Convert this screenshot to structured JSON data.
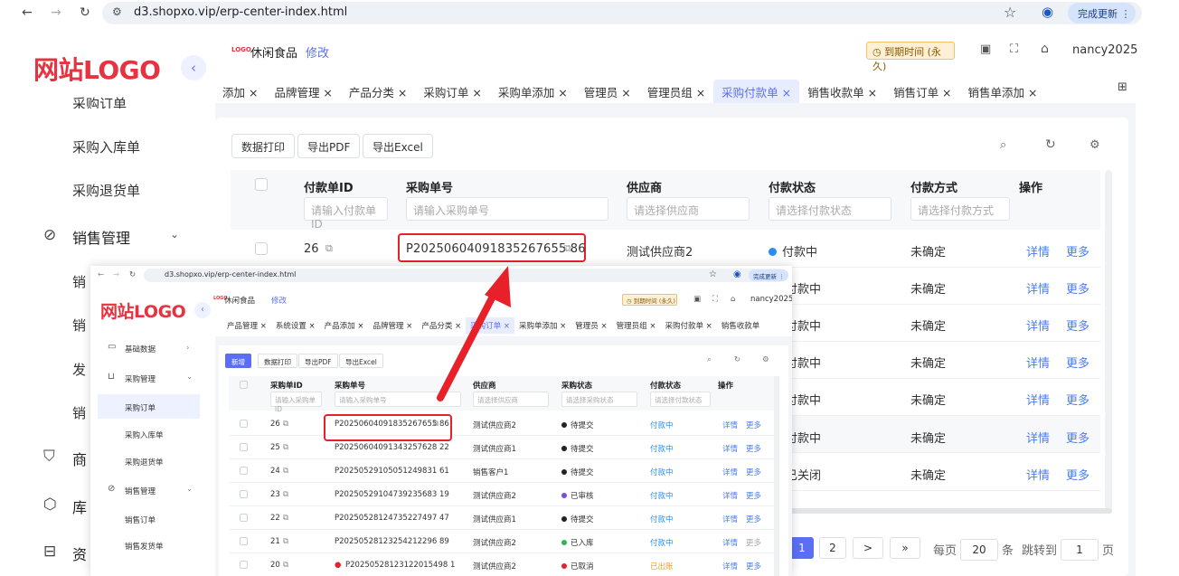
{
  "browser": {
    "url": "d3.shopxo.vip/erp-center-index.html",
    "update_label": "完成更新"
  },
  "sidebar": {
    "logo": "网站LOGO",
    "items": [
      {
        "label": "采购订单"
      },
      {
        "label": "采购入库单"
      },
      {
        "label": "采购退货单"
      },
      {
        "label": "销售管理"
      },
      {
        "label": "销"
      },
      {
        "label": "销"
      },
      {
        "label": "发"
      },
      {
        "label": "销"
      },
      {
        "label": "商"
      },
      {
        "label": "库"
      },
      {
        "label": "资"
      }
    ]
  },
  "header": {
    "shop_name": "休闲食品",
    "edit_label": "修改",
    "expiry": "到期时间 (永久)",
    "user": "nancy2025"
  },
  "tabs": [
    {
      "label": "添加 ×"
    },
    {
      "label": "品牌管理 ×"
    },
    {
      "label": "产品分类 ×"
    },
    {
      "label": "采购订单 ×"
    },
    {
      "label": "采购单添加 ×"
    },
    {
      "label": "管理员 ×"
    },
    {
      "label": "管理员组 ×"
    },
    {
      "label": "采购付款单 ×",
      "active": true
    },
    {
      "label": "销售收款单 ×"
    },
    {
      "label": "销售订单 ×"
    },
    {
      "label": "销售单添加 ×"
    }
  ],
  "toolbar": {
    "print": "数据打印",
    "pdf": "导出PDF",
    "excel": "导出Excel"
  },
  "table": {
    "columns": {
      "id": "付款单ID",
      "order_no": "采购单号",
      "supplier": "供应商",
      "status": "付款状态",
      "method": "付款方式",
      "ops": "操作"
    },
    "filters": {
      "id": "请输入付款单ID",
      "order_no": "请输入采购单号",
      "supplier": "请选择供应商",
      "status": "请选择付款状态",
      "method": "请选择付款方式"
    },
    "rows": [
      {
        "id": "26",
        "order_no": "P20250604091835267655 86",
        "supplier": "测试供应商2",
        "status": "付款中",
        "method": "未确定"
      },
      {
        "status": "付款中",
        "method": "未确定"
      },
      {
        "status": "付款中",
        "method": "未确定"
      },
      {
        "status": "付款中",
        "method": "未确定"
      },
      {
        "status": "付款中",
        "method": "未确定"
      },
      {
        "status": "付款中",
        "method": "未确定"
      },
      {
        "status": "已关闭",
        "method": "未确定"
      }
    ],
    "detail_label": "详情",
    "more_label": "更多"
  },
  "pagination": {
    "pages": [
      "1",
      "2"
    ],
    "next": ">",
    "last": "»",
    "per_page_label": "每页",
    "per_page": "20",
    "per_page_unit": "条",
    "jump_label": "跳转到",
    "jump_value": "1",
    "page_unit": "页"
  },
  "inset": {
    "url": "d3.shopxo.vip/erp-center-index.html",
    "update_label": "完成更新",
    "logo": "网站LOGO",
    "shop_name": "休闲食品",
    "edit_label": "修改",
    "expiry": "到期时间 (永久)",
    "user": "nancy2025",
    "tabs": [
      "产品管理 ×",
      "系统设置 ×",
      "产品添加 ×",
      "品牌管理 ×",
      "产品分类 ×",
      "采购订单 ×",
      "采购单添加 ×",
      "管理员 ×",
      "管理员组 ×",
      "采购付款单 ×",
      "销售收款单"
    ],
    "sidebar": [
      "基础数据",
      "采购管理",
      "采购订单",
      "采购入库单",
      "采购退货单",
      "销售管理",
      "销售订单",
      "销售发货单"
    ],
    "toolbar": {
      "add": "新增",
      "print": "数据打印",
      "pdf": "导出PDF",
      "excel": "导出Excel"
    },
    "columns": {
      "id": "采购单ID",
      "order_no": "采购单号",
      "supplier": "供应商",
      "status": "采购状态",
      "pay_status": "付款状态",
      "ops": "操作"
    },
    "filters": {
      "id": "请输入采购单ID",
      "order_no": "请输入采购单号",
      "supplier": "请选择供应商",
      "status": "请选择采购状态",
      "pay_status": "请选择付款状态"
    },
    "rows": [
      {
        "id": "26",
        "order_no": "P20250604091835267655 86",
        "supplier": "测试供应商2",
        "status": "待提交",
        "pay": "付款中"
      },
      {
        "id": "25",
        "order_no": "P20250604091343257628 22",
        "supplier": "测试供应商1",
        "status": "待提交",
        "pay": "付款中"
      },
      {
        "id": "24",
        "order_no": "P20250529105051249831 61",
        "supplier": "销售客户1",
        "status": "待提交",
        "pay": "付款中"
      },
      {
        "id": "23",
        "order_no": "P20250529104739235683 19",
        "supplier": "测试供应商2",
        "status": "已审核",
        "pay": "付款中"
      },
      {
        "id": "22",
        "order_no": "P20250528124735227497 47",
        "supplier": "测试供应商1",
        "status": "待提交",
        "pay": "付款中"
      },
      {
        "id": "21",
        "order_no": "P20250528123254212296 89",
        "supplier": "测试供应商2",
        "status": "已入库",
        "pay": "付款中"
      },
      {
        "id": "20",
        "order_no": "P20250528123122015498 1",
        "supplier": "测试供应商2",
        "status": "已取消",
        "pay": "已出账"
      }
    ],
    "detail_label": "详情",
    "more_label": "更多"
  },
  "colors": {
    "accent": "#5b6ff5",
    "logo_red": "#e8323f",
    "highlight_red": "#e8202a",
    "status_blue": "#2d8cf0"
  }
}
